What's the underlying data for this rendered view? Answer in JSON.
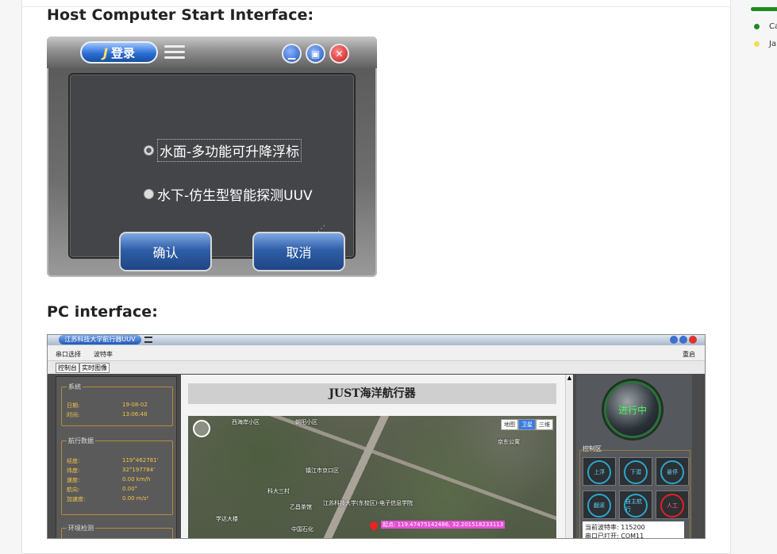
{
  "article": {
    "heading_login": "Host Computer Start Interface:",
    "heading_pc": "PC interface:"
  },
  "login_window": {
    "logo_text": "登录",
    "options": [
      "水面-多功能可升降浮标",
      "水下-仿生型智能探测UUV"
    ],
    "selected_option": 0,
    "confirm_label": "确认",
    "cancel_label": "取消"
  },
  "pc_window": {
    "window_title": "江苏科技大学航行器UUV",
    "menu": [
      "串口选择",
      "波特率"
    ],
    "menu_right": "重启",
    "tabs": [
      "控制台",
      "实时图像"
    ],
    "system": {
      "title": "系统",
      "rows": [
        {
          "label": "日期:",
          "value": "19-08-02"
        },
        {
          "label": "时间:",
          "value": "13:06:48"
        }
      ]
    },
    "nav": {
      "title": "航行数据",
      "rows": [
        {
          "label": "经度:",
          "value": "119°462781'"
        },
        {
          "label": "纬度:",
          "value": "32°197784'"
        },
        {
          "label": "速度:",
          "value": "0.00 km/h"
        },
        {
          "label": "航向:",
          "value": "0.00°"
        },
        {
          "label": "加速度:",
          "value": "0.00 m/s²"
        }
      ]
    },
    "env": {
      "title": "环境检测"
    },
    "map_title": "JUST海洋航行器",
    "map_type_tabs": [
      "地图",
      "卫星",
      "三维"
    ],
    "map_labels": [
      "西海岸小区",
      "朝阳小区",
      "江苏科技大学(东校区)-电子信息学院",
      "镇江市京口区",
      "京东公寓",
      "科大三村",
      "乙昌茶馆",
      "学达大楼",
      "中国石化"
    ],
    "coord_text": "起点: 119.47475142486, 32.201518233113",
    "status_label": "进行中",
    "control_title": "控制区",
    "control_buttons": [
      "上浮",
      "下潜",
      "悬停",
      "翻滚",
      "自主航行",
      "人工"
    ],
    "info_lines": [
      "当前波特率: 115200",
      "串口已打开: COM11"
    ]
  },
  "sidebar": {
    "items": [
      {
        "label": "Ca",
        "color": "#1e8a1e"
      },
      {
        "label": "Ja",
        "color": "#f0dc5a"
      }
    ]
  }
}
